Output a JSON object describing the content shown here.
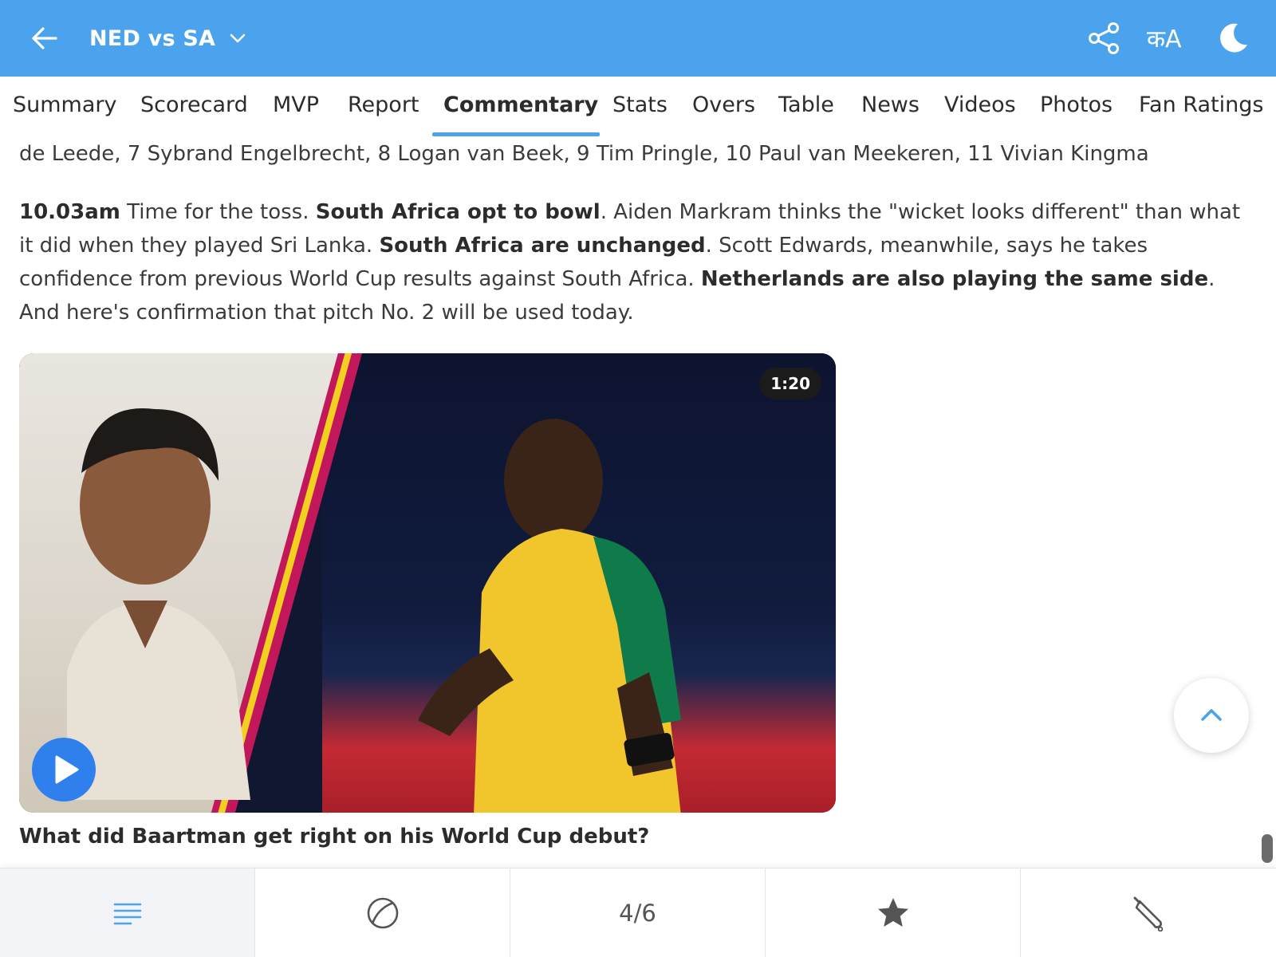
{
  "header": {
    "title": "NED vs SA",
    "lang_label": "कA",
    "colors": {
      "brand": "#4aa3ec"
    },
    "icons": [
      "back-arrow-icon",
      "chevron-down-icon",
      "share-icon",
      "language-icon",
      "moon-icon"
    ]
  },
  "tabs": [
    {
      "label": "Summary"
    },
    {
      "label": "Scorecard"
    },
    {
      "label": "MVP"
    },
    {
      "label": "Report"
    },
    {
      "label": "Commentary",
      "active": true
    },
    {
      "label": "Stats"
    },
    {
      "label": "Overs"
    },
    {
      "label": "Table"
    },
    {
      "label": "News"
    },
    {
      "label": "Videos"
    },
    {
      "label": "Photos"
    },
    {
      "label": "Fan Ratings"
    }
  ],
  "commentary": {
    "line1": "de Leede, 7 Sybrand Engelbrecht, 8 Logan van Beek, 9 Tim Pringle, 10 Paul van Meekeren, 11 Vivian Kingma",
    "toss": {
      "time": "10.03am",
      "t1": " Time for the toss. ",
      "b1": "South Africa opt to bowl",
      "t2": ". Aiden Markram thinks the \"wicket looks different\" than what it did when they played Sri Lanka. ",
      "b2": "South Africa are unchanged",
      "t3": ". Scott Edwards, meanwhile, says he takes confidence from previous World Cup results against South Africa. ",
      "b3": "Netherlands are also playing the same side",
      "t4": ". And here's confirmation that pitch No. 2 will be used today."
    }
  },
  "video": {
    "duration": "1:20",
    "caption": "What did Baartman get right on his World Cup debut?",
    "icons": [
      "play-icon"
    ]
  },
  "bottom_bar": {
    "items": [
      {
        "name": "commentary-list",
        "icon": "list-icon",
        "active": true
      },
      {
        "name": "ball",
        "icon": "cricket-ball-icon"
      },
      {
        "name": "page-counter",
        "text": "4/6"
      },
      {
        "name": "favourites",
        "icon": "star-icon"
      },
      {
        "name": "bat",
        "icon": "cricket-bat-icon"
      }
    ]
  }
}
